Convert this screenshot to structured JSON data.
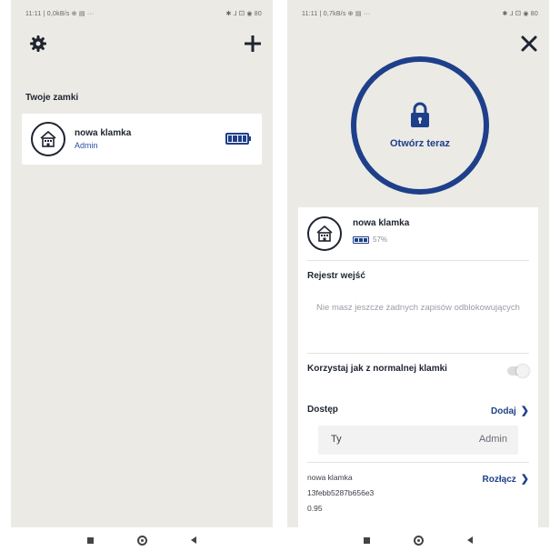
{
  "left_screen": {
    "status": {
      "time_info": "11:11 | 0,0kB/s ⊕ ▤ ···",
      "icons": "✱ ⅃ ⚀ ◉ 80"
    },
    "section_title": "Twoje zamki",
    "lock": {
      "name": "nowa klamka",
      "role": "Admin",
      "battery_level_pct": 80
    }
  },
  "right_screen": {
    "status": {
      "time_info": "11:11 | 0,7kB/s ⊕ ▤ ···",
      "icons": "✱ ⅃ ⚀ ◉ 80"
    },
    "open_button_label": "Otwórz teraz",
    "lock": {
      "name": "nowa klamka",
      "battery_text": "57%",
      "battery_level_pct": 57
    },
    "log": {
      "title": "Rejestr wejść",
      "empty_message": "Nie masz jeszcze żadnych zapisów odblokowujących"
    },
    "normal_handle": {
      "label": "Korzystaj jak z normalnej klamki",
      "enabled": false
    },
    "access": {
      "title": "Dostęp",
      "add_label": "Dodaj",
      "users": [
        {
          "name": "Ty",
          "role": "Admin"
        }
      ]
    },
    "device": {
      "name": "nowa klamka",
      "id": "13febb5287b656e3",
      "version": "0.95",
      "disconnect_label": "Rozłącz"
    }
  },
  "colors": {
    "accent": "#1e3f8a",
    "background": "#ebeae5",
    "card": "#ffffff",
    "muted_text": "#9a9da5"
  }
}
